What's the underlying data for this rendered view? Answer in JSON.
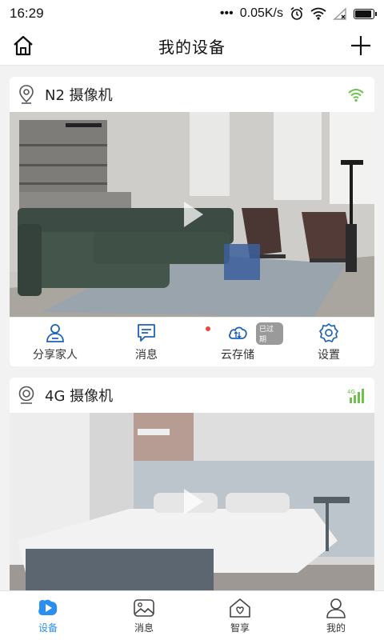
{
  "status": {
    "time": "16:29",
    "network_speed": "0.05K/s",
    "battery_level": 0.85
  },
  "header": {
    "title": "我的设备"
  },
  "devices": [
    {
      "name": "N2 摄像机",
      "type_icon": "camera-location-icon",
      "signal_icon": "wifi-icon",
      "actions": [
        {
          "label": "分享家人",
          "icon": "share-user-icon"
        },
        {
          "label": "消息",
          "icon": "message-icon"
        },
        {
          "label": "云存储",
          "icon": "cloud-icon",
          "badge": "已过期"
        },
        {
          "label": "设置",
          "icon": "gear-icon"
        }
      ]
    },
    {
      "name": "4G 摄像机",
      "type_icon": "camera-round-icon",
      "signal_icon": "cellular-4g-icon"
    }
  ],
  "bottom_nav": [
    {
      "label": "设备",
      "icon": "play-icon"
    },
    {
      "label": "消息",
      "icon": "image-icon"
    },
    {
      "label": "智享",
      "icon": "heart-home-icon"
    },
    {
      "label": "我的",
      "icon": "person-icon"
    }
  ],
  "colors": {
    "accent": "#2b8ff0",
    "signal_green": "#6cc24a",
    "badge_gray": "#9a9a9a"
  }
}
